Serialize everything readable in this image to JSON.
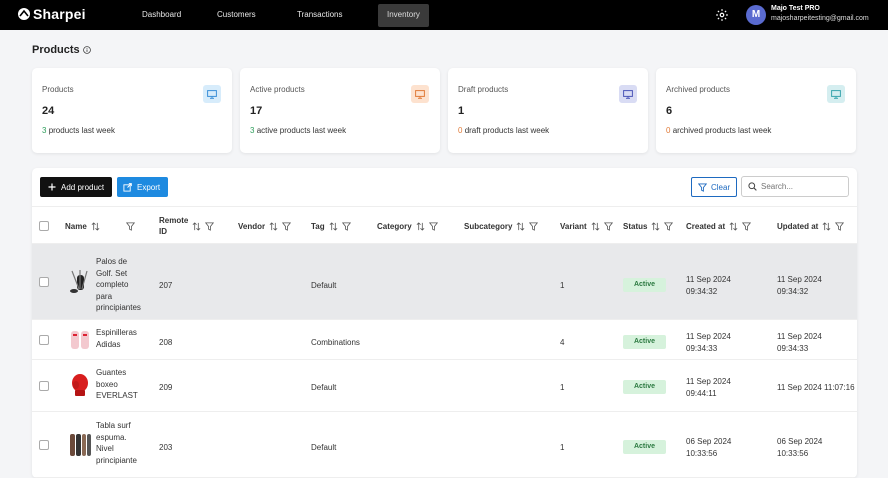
{
  "app": {
    "brand": "Sharpei"
  },
  "nav": [
    {
      "label": "Dashboard"
    },
    {
      "label": "Customers"
    },
    {
      "label": "Transactions"
    },
    {
      "label": "Inventory"
    }
  ],
  "user": {
    "initial": "M",
    "name": "Majo Test PRO",
    "email": "majosharpeitesting@gmail.com"
  },
  "page": {
    "title": "Products"
  },
  "cards": [
    {
      "label": "Products",
      "value": "24",
      "delta": "3",
      "delta_text": "products last week",
      "icon": "monitor-icon",
      "icon_bg": "#d7ecfb",
      "icon_color": "#3b8fd8"
    },
    {
      "label": "Active products",
      "value": "17",
      "delta": "3",
      "delta_text": "active products last week",
      "icon": "monitor-icon",
      "icon_bg": "#fde2cf",
      "icon_color": "#e07b39"
    },
    {
      "label": "Draft products",
      "value": "1",
      "delta": "0",
      "delta_text": "draft products last week",
      "icon": "monitor-icon",
      "icon_bg": "#d9dcf4",
      "icon_color": "#4b56b8"
    },
    {
      "label": "Archived products",
      "value": "6",
      "delta": "0",
      "delta_text": "archived products last week",
      "icon": "monitor-icon",
      "icon_bg": "#d5eef0",
      "icon_color": "#3aa5ae"
    }
  ],
  "toolbar": {
    "add_label": "Add product",
    "export_label": "Export",
    "clear_label": "Clear",
    "search_placeholder": "Search..."
  },
  "columns": [
    {
      "label": "Name"
    },
    {
      "label": "Remote\nID"
    },
    {
      "label": "Vendor"
    },
    {
      "label": "Tag"
    },
    {
      "label": "Category"
    },
    {
      "label": "Subcategory"
    },
    {
      "label": "Variant"
    },
    {
      "label": "Status"
    },
    {
      "label": "Created at"
    },
    {
      "label": "Updated at"
    }
  ],
  "rows": [
    {
      "name": "Palos de\nGolf. Set\ncompleto\npara\nprincipiantes",
      "remote_id": "207",
      "vendor": "",
      "tag": "Default",
      "category": "",
      "subcategory": "",
      "variant": "1",
      "status": "Active",
      "created": "11 Sep 2024\n09:34:32",
      "updated": "11 Sep 2024\n09:34:32",
      "thumb": "golf-set-thumbnail"
    },
    {
      "name": "Espinilleras\nAdidas",
      "remote_id": "208",
      "vendor": "",
      "tag": "Combinations",
      "category": "",
      "subcategory": "",
      "variant": "4",
      "status": "Active",
      "created": "11 Sep 2024\n09:34:33",
      "updated": "11 Sep 2024\n09:34:33",
      "thumb": "shin-guards-thumbnail"
    },
    {
      "name": "Guantes\nboxeo\nEVERLAST",
      "remote_id": "209",
      "vendor": "",
      "tag": "Default",
      "category": "",
      "subcategory": "",
      "variant": "1",
      "status": "Active",
      "created": "11 Sep 2024\n09:44:11",
      "updated": "11 Sep 2024 11:07:16",
      "thumb": "boxing-glove-thumbnail"
    },
    {
      "name": "Tabla surf\nespuma.\nNivel\nprincipiante",
      "remote_id": "203",
      "vendor": "",
      "tag": "Default",
      "category": "",
      "subcategory": "",
      "variant": "1",
      "status": "Active",
      "created": "06 Sep 2024\n10:33:56",
      "updated": "06 Sep 2024\n10:33:56",
      "thumb": "surfboard-thumbnail"
    }
  ]
}
